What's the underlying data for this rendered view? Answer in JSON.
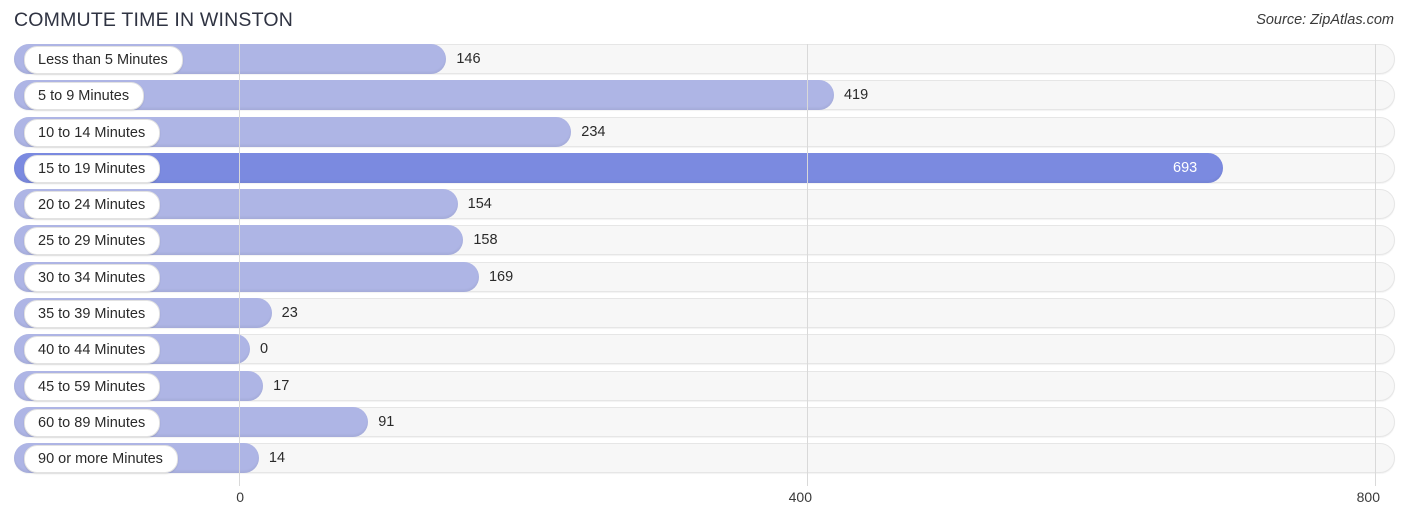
{
  "header": {
    "title": "COMMUTE TIME IN WINSTON",
    "source": "Source: ZipAtlas.com"
  },
  "colors": {
    "bar": "#aeb5e5",
    "bar_highlight": "#7b8ae0",
    "track": "#f7f7f7",
    "gridline": "#d9d9d9",
    "title_text": "#2f3342",
    "value_text": "#2a2a2a",
    "value_text_inside": "#ffffff"
  },
  "chart_data": {
    "type": "bar",
    "orientation": "horizontal",
    "title": "COMMUTE TIME IN WINSTON",
    "xlabel": "",
    "ylabel": "",
    "xlim": [
      0,
      800
    ],
    "xticks": [
      0,
      400,
      800
    ],
    "xtick_labels": [
      "0",
      "400",
      "800"
    ],
    "grid": true,
    "legend": null,
    "categories": [
      "Less than 5 Minutes",
      "5 to 9 Minutes",
      "10 to 14 Minutes",
      "15 to 19 Minutes",
      "20 to 24 Minutes",
      "25 to 29 Minutes",
      "30 to 34 Minutes",
      "35 to 39 Minutes",
      "40 to 44 Minutes",
      "45 to 59 Minutes",
      "60 to 89 Minutes",
      "90 or more Minutes"
    ],
    "values": [
      146,
      419,
      234,
      693,
      154,
      158,
      169,
      23,
      0,
      17,
      91,
      14
    ],
    "value_labels": [
      "146",
      "419",
      "234",
      "693",
      "154",
      "158",
      "169",
      "23",
      "0",
      "17",
      "91",
      "14"
    ],
    "highlight_index": 3,
    "bars": [
      {
        "label": "Less than 5 Minutes",
        "value": 146,
        "value_label": "146",
        "highlight": false
      },
      {
        "label": "5 to 9 Minutes",
        "value": 419,
        "value_label": "419",
        "highlight": false
      },
      {
        "label": "10 to 14 Minutes",
        "value": 234,
        "value_label": "234",
        "highlight": false
      },
      {
        "label": "15 to 19 Minutes",
        "value": 693,
        "value_label": "693",
        "highlight": true
      },
      {
        "label": "20 to 24 Minutes",
        "value": 154,
        "value_label": "154",
        "highlight": false
      },
      {
        "label": "25 to 29 Minutes",
        "value": 158,
        "value_label": "158",
        "highlight": false
      },
      {
        "label": "30 to 34 Minutes",
        "value": 169,
        "value_label": "169",
        "highlight": false
      },
      {
        "label": "35 to 39 Minutes",
        "value": 23,
        "value_label": "23",
        "highlight": false
      },
      {
        "label": "40 to 44 Minutes",
        "value": 0,
        "value_label": "0",
        "highlight": false
      },
      {
        "label": "45 to 59 Minutes",
        "value": 17,
        "value_label": "17",
        "highlight": false
      },
      {
        "label": "60 to 89 Minutes",
        "value": 91,
        "value_label": "91",
        "highlight": false
      },
      {
        "label": "90 or more Minutes",
        "value": 14,
        "value_label": "14",
        "highlight": false
      }
    ]
  }
}
